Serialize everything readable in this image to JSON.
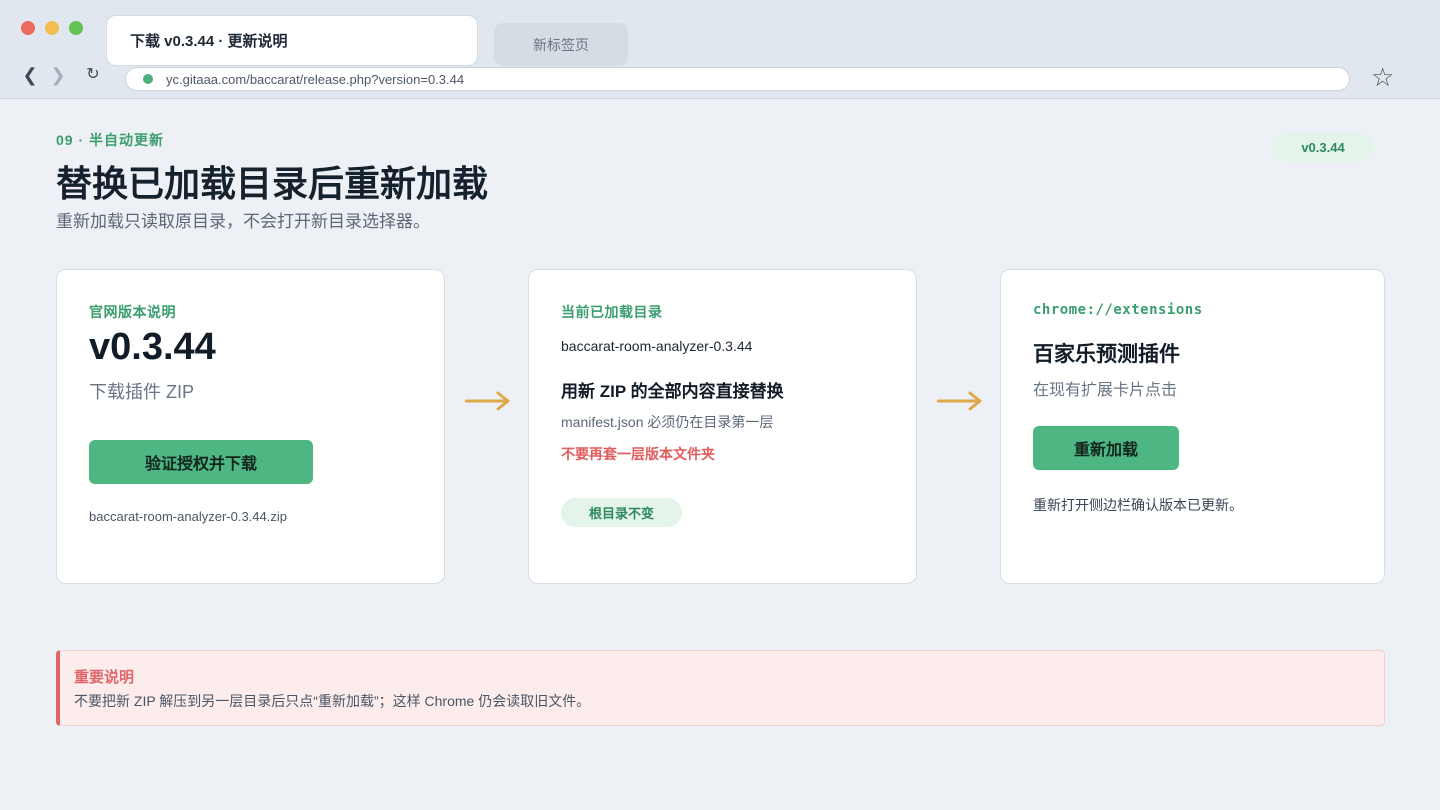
{
  "browser": {
    "active_tab": "下载 v0.3.44 · 更新说明",
    "inactive_tab": "新标签页",
    "url": "yc.gitaaa.com/baccarat/release.php?version=0.3.44",
    "nav": {
      "back": "❮",
      "forward": "❯",
      "reload": "↻",
      "bookmark": "☆"
    }
  },
  "header": {
    "eyebrow": "09 · 半自动更新",
    "title": "替换已加载目录后重新加载",
    "subtitle": "重新加载只读取原目录，不会打开新目录选择器。",
    "version_badge": "v0.3.44"
  },
  "cards": {
    "official": {
      "label": "官网版本说明",
      "version": "v0.3.44",
      "subtitle": "下载插件 ZIP",
      "button": "验证授权并下载",
      "filename": "baccarat-room-analyzer-0.3.44.zip"
    },
    "loaded_dir": {
      "label": "当前已加载目录",
      "dir_name": "baccarat-room-analyzer-0.3.44",
      "title": "用新 ZIP 的全部内容直接替换",
      "manifest_note": "manifest.json 必须仍在目录第一层",
      "warning": "不要再套一层版本文件夹",
      "badge": "根目录不变"
    },
    "extensions": {
      "label": "chrome://extensions",
      "plugin_name": "百家乐预测插件",
      "subtitle": "在现有扩展卡片点击",
      "button": "重新加载",
      "note": "重新打开侧边栏确认版本已更新。"
    }
  },
  "notice": {
    "title": "重要说明",
    "body": "不要把新 ZIP 解压到另一层目录后只点“重新加载”；这样 Chrome 仍会读取旧文件。"
  },
  "colors": {
    "accent_green": "#4db683",
    "label_green": "#3a9e6d",
    "warning_red": "#e05d5d",
    "arrow_gold": "#dfa84a"
  }
}
